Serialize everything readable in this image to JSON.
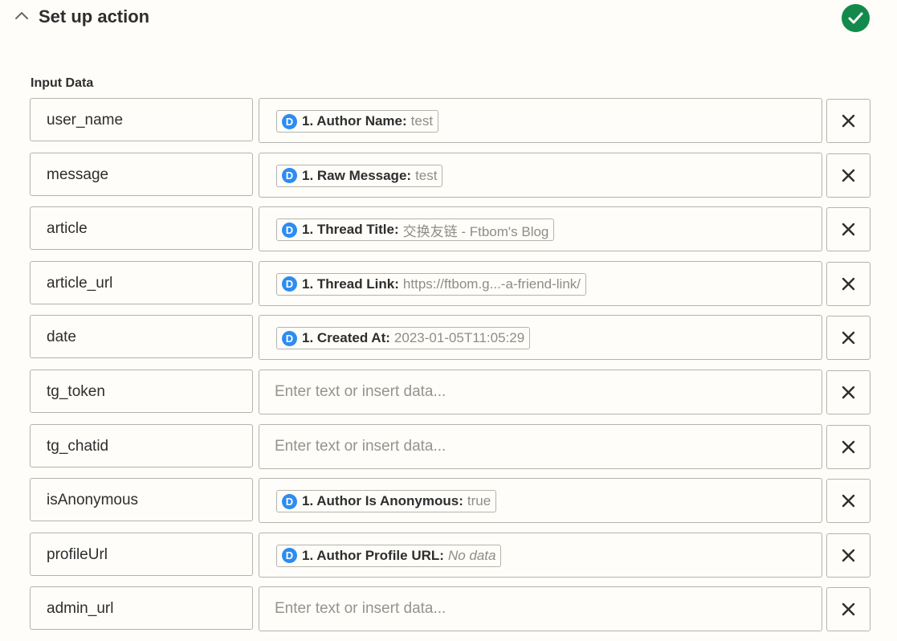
{
  "header": {
    "title": "Set up action",
    "status_icon": "check-circle-icon",
    "status_color": "#138a4c"
  },
  "input_data": {
    "label": "Input Data",
    "placeholder": "Enter text or insert data...",
    "app_icon_letter": "D",
    "app_icon_color": "#2d8cf0",
    "rows": [
      {
        "key": "user_name",
        "pill": {
          "label": "1. Author Name:",
          "value": "test"
        }
      },
      {
        "key": "message",
        "pill": {
          "label": "1. Raw Message:",
          "value": "test"
        }
      },
      {
        "key": "article",
        "pill": {
          "label": "1. Thread Title:",
          "value": "交换友链 - Ftbom's Blog"
        }
      },
      {
        "key": "article_url",
        "pill": {
          "label": "1. Thread Link:",
          "value": "https://ftbom.g...-a-friend-link/"
        }
      },
      {
        "key": "date",
        "pill": {
          "label": "1. Created At:",
          "value": "2023-01-05T11:05:29"
        }
      },
      {
        "key": "tg_token",
        "pill": null
      },
      {
        "key": "tg_chatid",
        "pill": null
      },
      {
        "key": "isAnonymous",
        "pill": {
          "label": "1. Author Is Anonymous:",
          "value": "true"
        }
      },
      {
        "key": "profileUrl",
        "pill": {
          "label": "1. Author Profile URL:",
          "value": "No data",
          "italic": true
        }
      },
      {
        "key": "admin_url",
        "pill": null
      }
    ]
  }
}
